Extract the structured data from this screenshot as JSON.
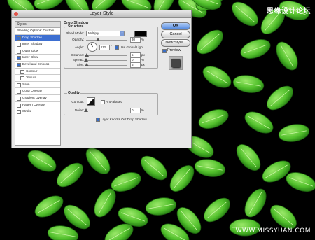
{
  "window": {
    "title": "Layer Style"
  },
  "watermark": {
    "top": "思缘设计论坛",
    "bottom": "WWW.MISSYUAN.COM"
  },
  "styles_list": {
    "header": "Styles",
    "items": [
      {
        "label": "Blending Options: Custom",
        "check": null,
        "selected": false,
        "sub": false
      },
      {
        "label": "Drop Shadow",
        "check": true,
        "selected": true,
        "sub": false
      },
      {
        "label": "Inner Shadow",
        "check": false,
        "selected": false,
        "sub": false
      },
      {
        "label": "Outer Glow",
        "check": false,
        "selected": false,
        "sub": false
      },
      {
        "label": "Inner Glow",
        "check": true,
        "selected": false,
        "sub": false
      },
      {
        "label": "Bevel and Emboss",
        "check": true,
        "selected": false,
        "sub": false
      },
      {
        "label": "Contour",
        "check": false,
        "selected": false,
        "sub": true
      },
      {
        "label": "Texture",
        "check": false,
        "selected": false,
        "sub": true
      },
      {
        "label": "Satin",
        "check": false,
        "selected": false,
        "sub": false
      },
      {
        "label": "Color Overlay",
        "check": false,
        "selected": false,
        "sub": false
      },
      {
        "label": "Gradient Overlay",
        "check": false,
        "selected": false,
        "sub": false
      },
      {
        "label": "Pattern Overlay",
        "check": false,
        "selected": false,
        "sub": false
      },
      {
        "label": "Stroke",
        "check": false,
        "selected": false,
        "sub": false
      }
    ]
  },
  "drop_shadow": {
    "title": "Drop Shadow",
    "structure": {
      "legend": "Structure",
      "blend_mode_label": "Blend Mode:",
      "blend_mode_value": "Multiply",
      "shadow_color": "#000000",
      "opacity_label": "Opacity:",
      "opacity_value": "30",
      "opacity_unit": "%",
      "opacity_level": 0.3,
      "angle_label": "Angle:",
      "angle_value": "112",
      "angle_unit": "°",
      "global_light_label": "Use Global Light",
      "global_light_checked": true,
      "distance_label": "Distance:",
      "distance_value": "5",
      "distance_unit": "px",
      "distance_level": 0.02,
      "spread_label": "Spread:",
      "spread_value": "0",
      "spread_unit": "%",
      "spread_level": 0.0,
      "size_label": "Size:",
      "size_value": "5",
      "size_unit": "px",
      "size_level": 0.02
    },
    "quality": {
      "legend": "Quality",
      "contour_label": "Contour:",
      "anti_aliased_label": "Anti-aliased",
      "anti_aliased_checked": false,
      "noise_label": "Noise:",
      "noise_value": "0",
      "noise_unit": "%",
      "noise_level": 0.0
    },
    "knockout_label": "Layer Knocks Out Drop Shadow",
    "knockout_checked": true
  },
  "buttons": {
    "ok": "OK",
    "cancel": "Cancel",
    "new_style": "New Style...",
    "preview_label": "Preview",
    "preview_checked": true
  }
}
